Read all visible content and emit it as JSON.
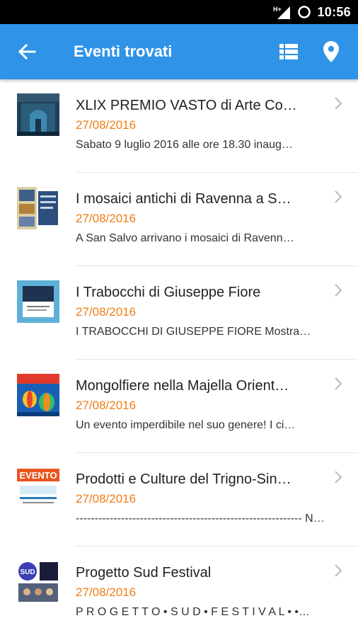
{
  "status": {
    "time": "10:56",
    "network": "H+"
  },
  "appbar": {
    "title": "Eventi trovati"
  },
  "events": [
    {
      "title": "XLIX PREMIO VASTO di Arte Co…",
      "date": "27/08/2016",
      "desc": "Sabato 9 luglio 2016 alle ore 18.30 inaug…"
    },
    {
      "title": "I mosaici antichi di Ravenna a S…",
      "date": "27/08/2016",
      "desc": "A San Salvo arrivano i mosaici di Ravenn…"
    },
    {
      "title": "I Trabocchi di Giuseppe Fiore",
      "date": "27/08/2016",
      "desc": "I TRABOCCHI DI GIUSEPPE FIORE Mostra…"
    },
    {
      "title": "Mongolfiere nella Majella Orient…",
      "date": "27/08/2016",
      "desc": "Un evento imperdibile nel suo genere! I ci…"
    },
    {
      "title": "Prodotti e Culture del Trigno-Sin…",
      "date": "27/08/2016",
      "desc": "------------------------------------------------------------ N…"
    },
    {
      "title": "Progetto Sud Festival",
      "date": "27/08/2016",
      "desc": "P R O G E T T O • S U D • F E S T I V A L • •…"
    }
  ],
  "thumb_logos": {
    "evento": "EVENTO",
    "sud": "SUD"
  },
  "colors": {
    "appbar": "#2f93e8",
    "date": "#ef7d16",
    "statusbar": "#000000"
  }
}
